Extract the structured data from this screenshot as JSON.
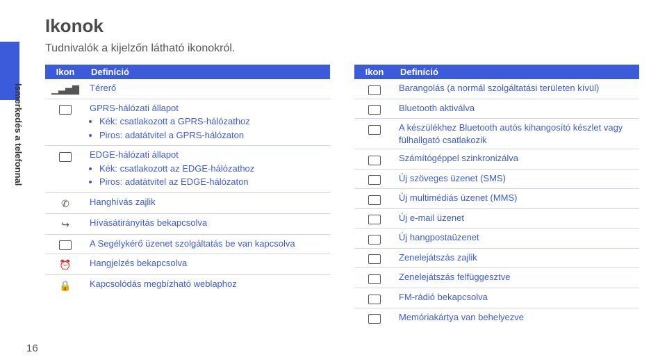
{
  "side_label": "Ismerkedés a telefonnal",
  "title": "Ikonok",
  "subtitle": "Tudnivalók a kijelzőn látható ikonokról.",
  "page_number": "16",
  "headers": {
    "icon": "Ikon",
    "definition": "Definíció"
  },
  "left": {
    "rows": [
      {
        "icon": "signal-strength-icon",
        "def": "Térerő"
      },
      {
        "icon": "gprs-icon",
        "head": "GPRS-hálózati állapot",
        "bullets": [
          "Kék: csatlakozott a GPRS-hálózathoz",
          "Piros: adatátvitel a GPRS-hálózaton"
        ]
      },
      {
        "icon": "edge-icon",
        "head": "EDGE-hálózati állapot",
        "bullets": [
          "Kék: csatlakozott az EDGE-hálózathoz",
          "Piros: adatátvitel az EDGE-hálózaton"
        ]
      },
      {
        "icon": "call-active-icon",
        "def": "Hanghívás zajlik"
      },
      {
        "icon": "call-forward-icon",
        "def": "Hívásátirányítás bekapcsolva"
      },
      {
        "icon": "sos-icon",
        "def": "A Segélykérő üzenet szolgáltatás be van kapcsolva"
      },
      {
        "icon": "alarm-icon",
        "def": "Hangjelzés bekapcsolva"
      },
      {
        "icon": "secure-web-icon",
        "def": "Kapcsolódás megbízható weblaphoz"
      }
    ]
  },
  "right": {
    "rows": [
      {
        "icon": "roaming-icon",
        "def": "Barangolás (a normál szolgáltatási területen kívül)"
      },
      {
        "icon": "bluetooth-icon",
        "def": "Bluetooth aktiválva"
      },
      {
        "icon": "bt-carkit-icon",
        "def": "A készülékhez Bluetooth autós kihangosító készlet vagy fülhallgató csatlakozik"
      },
      {
        "icon": "sync-pc-icon",
        "def": "Számítógéppel szinkronizálva"
      },
      {
        "icon": "sms-icon",
        "def": "Új szöveges üzenet (SMS)"
      },
      {
        "icon": "mms-icon",
        "def": "Új multimédiás üzenet (MMS)"
      },
      {
        "icon": "email-icon",
        "def": "Új e-mail üzenet"
      },
      {
        "icon": "voicemail-icon",
        "def": "Új hangpostaüzenet"
      },
      {
        "icon": "music-play-icon",
        "def": "Zenelejátszás zajlik"
      },
      {
        "icon": "music-pause-icon",
        "def": "Zenelejátszás felfüggesztve"
      },
      {
        "icon": "fm-radio-icon",
        "def": "FM-rádió bekapcsolva"
      },
      {
        "icon": "memory-card-icon",
        "def": "Memóriakártya van behelyezve"
      }
    ]
  }
}
